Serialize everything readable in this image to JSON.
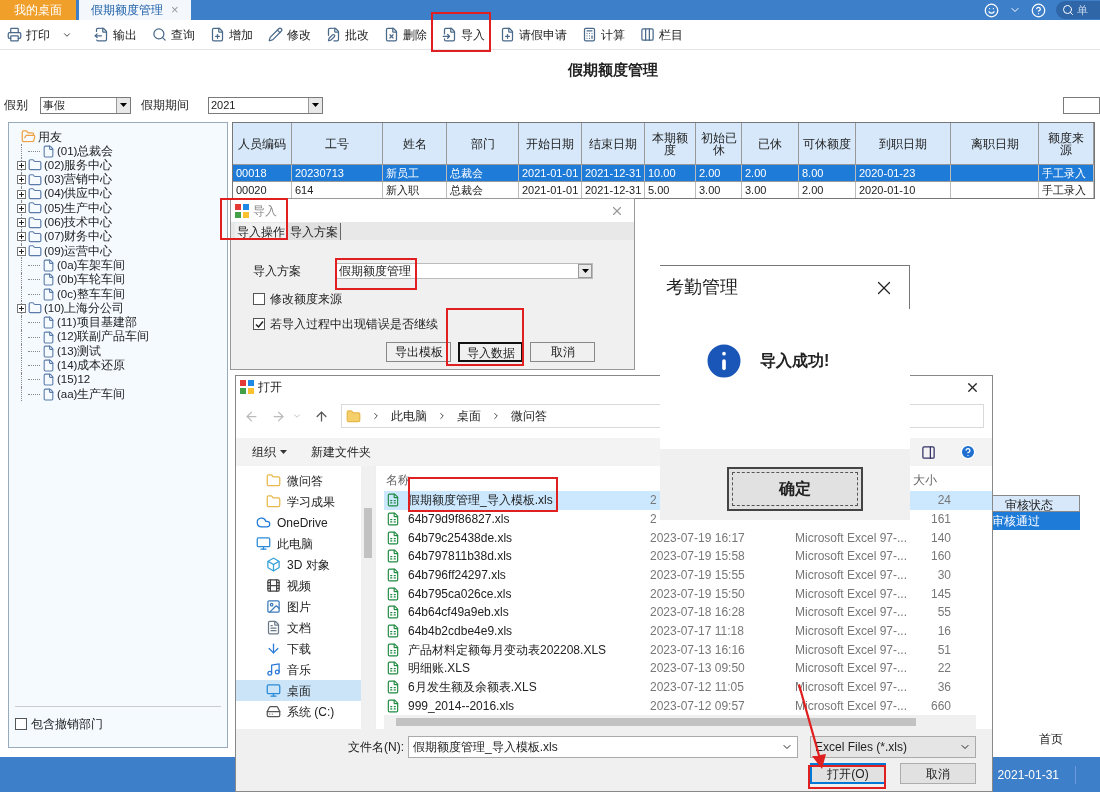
{
  "tabs": [
    {
      "label": "我的桌面",
      "selected": false
    },
    {
      "label": "假期额度管理",
      "selected": true,
      "close": "×"
    }
  ],
  "search_text": "单",
  "toolbar": [
    {
      "label": "打印",
      "dropdown": true
    },
    {
      "label": "输出",
      "dropdown": false
    },
    {
      "label": "查询",
      "dropdown": false
    },
    {
      "label": "增加",
      "dropdown": false
    },
    {
      "label": "修改",
      "dropdown": false
    },
    {
      "label": "批改",
      "dropdown": false
    },
    {
      "label": "删除",
      "dropdown": false
    },
    {
      "label": "导入",
      "dropdown": false
    },
    {
      "label": "请假申请",
      "dropdown": false
    },
    {
      "label": "计算",
      "dropdown": false
    },
    {
      "label": "栏目",
      "dropdown": false
    }
  ],
  "page_title": "假期额度管理",
  "filters": [
    {
      "label": "假别",
      "value": "事假"
    },
    {
      "label": "假期期间",
      "value": "2021"
    }
  ],
  "tree": {
    "label": "用友",
    "children": [
      {
        "label": "(01)总裁会",
        "kind": "leaf"
      },
      {
        "label": "(02)服务中心",
        "kind": "folder"
      },
      {
        "label": "(03)营销中心",
        "kind": "folder"
      },
      {
        "label": "(04)供应中心",
        "kind": "folder"
      },
      {
        "label": "(05)生产中心",
        "kind": "folder"
      },
      {
        "label": "(06)技术中心",
        "kind": "folder"
      },
      {
        "label": "(07)财务中心",
        "kind": "folder"
      },
      {
        "label": "(09)运营中心",
        "kind": "folder"
      },
      {
        "label": "(0a)车架车间",
        "kind": "leaf"
      },
      {
        "label": "(0b)车轮车间",
        "kind": "leaf"
      },
      {
        "label": "(0c)整车车间",
        "kind": "leaf"
      },
      {
        "label": "(10)上海分公司",
        "kind": "folder"
      },
      {
        "label": "(11)项目基建部",
        "kind": "leaf"
      },
      {
        "label": "(12)联副产品车间",
        "kind": "leaf"
      },
      {
        "label": "(13)测试",
        "kind": "leaf"
      },
      {
        "label": "(14)成本还原",
        "kind": "leaf"
      },
      {
        "label": "(15)12",
        "kind": "leaf"
      },
      {
        "label": "(aa)生产车间",
        "kind": "leaf"
      }
    ]
  },
  "include_revoked": {
    "label": "包含撤销部门",
    "checked": false
  },
  "table": {
    "columns": [
      "人员编码",
      "工号",
      "姓名",
      "部门",
      "开始日期",
      "结束日期",
      "本期额度",
      "初始已休",
      "已休",
      "可休额度",
      "到职日期",
      "离职日期",
      "额度来源"
    ],
    "rows": [
      {
        "selected": true,
        "cells": [
          "00018",
          "20230713",
          "新员工",
          "总裁会",
          "2021-01-01",
          "2021-12-31",
          "10.00",
          "2.00",
          "2.00",
          "8.00",
          "2020-01-23",
          null,
          "手工录入"
        ]
      },
      {
        "selected": false,
        "cells": [
          "00020",
          "614",
          "新入职",
          "总裁会",
          "2021-01-01",
          "2021-12-31",
          "5.00",
          "3.00",
          "3.00",
          "2.00",
          "2020-01-10",
          null,
          "手工录入"
        ]
      }
    ]
  },
  "review_peek": {
    "column": "审核状态",
    "cell": "审核通过",
    "selected": true
  },
  "pager": "首页",
  "status_bar": {
    "date": "2021-01-31"
  },
  "import_dialog": {
    "title": "导入",
    "tabs": [
      {
        "label": "导入操作",
        "selected": true
      },
      {
        "label": "导入方案",
        "selected": false
      }
    ],
    "scheme_label": "导入方案",
    "scheme_value": "假期额度管理",
    "options": [
      {
        "label": "修改额度来源",
        "checked": false
      },
      {
        "label": "若导入过程中出现错误是否继续",
        "checked": true
      }
    ],
    "buttons": [
      {
        "label": "导出模板",
        "focused": false
      },
      {
        "label": "导入数据",
        "focused": true
      },
      {
        "label": "取消",
        "focused": false
      }
    ]
  },
  "message_box": {
    "title": "考勤管理",
    "message": "导入成功!",
    "button": "确定"
  },
  "open_dialog": {
    "title": "打开",
    "breadcrumb": [
      "此电脑",
      "桌面",
      "微问答"
    ],
    "organize": "组织",
    "new_folder": "新建文件夹",
    "nav": [
      {
        "label": "微问答",
        "kind": "folder",
        "selected": false
      },
      {
        "label": "学习成果",
        "kind": "folder",
        "selected": false
      },
      {
        "label": "OneDrive",
        "kind": "cloud",
        "selected": false
      },
      {
        "label": "此电脑",
        "kind": "pc",
        "selected": false,
        "children": [
          {
            "label": "3D 对象",
            "kind": "cube",
            "selected": false
          },
          {
            "label": "视频",
            "kind": "video",
            "selected": false
          },
          {
            "label": "图片",
            "kind": "image",
            "selected": false
          },
          {
            "label": "文档",
            "kind": "doc",
            "selected": false
          },
          {
            "label": "下载",
            "kind": "download",
            "selected": false
          },
          {
            "label": "音乐",
            "kind": "music",
            "selected": false
          },
          {
            "label": "桌面",
            "kind": "desktop",
            "selected": true
          },
          {
            "label": "系统 (C:)",
            "kind": "drive",
            "selected": false
          }
        ]
      }
    ],
    "columns": {
      "name": "名称",
      "size": "大小"
    },
    "files": [
      {
        "name": "假期额度管理_导入模板.xls",
        "date": "2",
        "size": "24",
        "selected": true
      },
      {
        "name": "64b79d9f86827.xls",
        "date": "2",
        "size": "161",
        "selected": false
      },
      {
        "name": "64b79c25438de.xls",
        "date": "2023-07-19 16:17",
        "type": "Microsoft Excel 97-...",
        "size": "140",
        "selected": false
      },
      {
        "name": "64b797811b38d.xls",
        "date": "2023-07-19 15:58",
        "type": "Microsoft Excel 97-...",
        "size": "160",
        "selected": false
      },
      {
        "name": "64b796ff24297.xls",
        "date": "2023-07-19 15:55",
        "type": "Microsoft Excel 97-...",
        "size": "30",
        "selected": false
      },
      {
        "name": "64b795ca026ce.xls",
        "date": "2023-07-19 15:50",
        "type": "Microsoft Excel 97-...",
        "size": "145",
        "selected": false
      },
      {
        "name": "64b64cf49a9eb.xls",
        "date": "2023-07-18 16:28",
        "type": "Microsoft Excel 97-...",
        "size": "55",
        "selected": false
      },
      {
        "name": "64b4b2cdbe4e9.xls",
        "date": "2023-07-17 11:18",
        "type": "Microsoft Excel 97-...",
        "size": "16",
        "selected": false
      },
      {
        "name": "产品材料定额每月变动表202208.XLS",
        "date": "2023-07-13 16:16",
        "type": "Microsoft Excel 97-...",
        "size": "51",
        "selected": false
      },
      {
        "name": "明细账.XLS",
        "date": "2023-07-13 09:50",
        "type": "Microsoft Excel 97-...",
        "size": "22",
        "selected": false
      },
      {
        "name": "6月发生额及余额表.XLS",
        "date": "2023-07-12 11:05",
        "type": "Microsoft Excel 97-...",
        "size": "36",
        "selected": false
      },
      {
        "name": "999_2014--2016.xls",
        "date": "2023-07-12 09:57",
        "type": "Microsoft Excel 97-...",
        "size": "660",
        "selected": false
      }
    ],
    "filename_label": "文件名(N):",
    "filename": "假期额度管理_导入模板.xls",
    "filter": "Excel Files (*.xls)",
    "buttons": [
      {
        "label": "打开(O)",
        "default": true
      },
      {
        "label": "取消",
        "default": false
      }
    ]
  }
}
